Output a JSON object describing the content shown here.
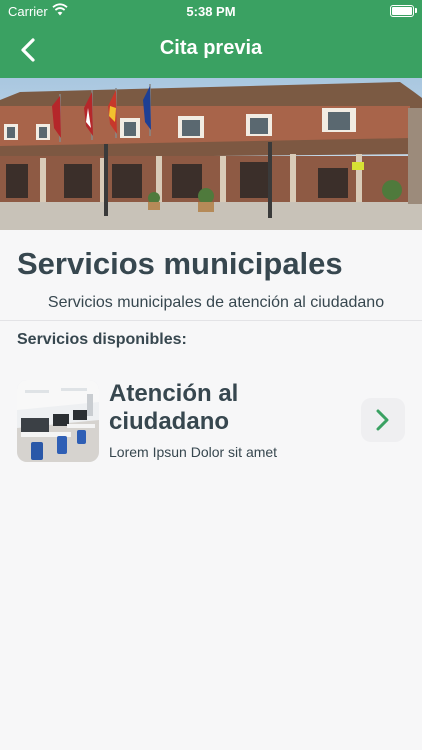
{
  "status_bar": {
    "carrier": "Carrier",
    "time": "5:38 PM"
  },
  "nav": {
    "title": "Cita previa",
    "back_icon": "chevron-left-icon"
  },
  "hero": {
    "image": "town-hall-photo"
  },
  "page": {
    "title": "Servicios municipales",
    "subtitle": "Servicios municipales de atención al ciudadano",
    "section_label": "Servicios disponibles:"
  },
  "services": [
    {
      "title": "Atención al ciudadano",
      "description": "Lorem Ipsun Dolor sit amet",
      "thumbnail": "office-photo",
      "action_icon": "chevron-right-icon"
    }
  ],
  "colors": {
    "brand_green": "#3aa162",
    "text": "#37474f",
    "background": "#f7f7f8"
  }
}
